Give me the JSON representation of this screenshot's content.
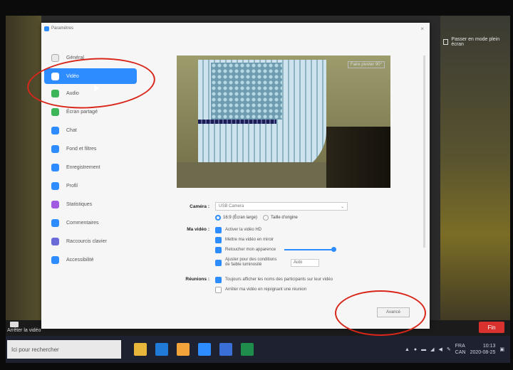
{
  "background": {
    "top_right_notice": "Passer en mode plein écran",
    "stop_video": "Arrêter la vidéo",
    "end_button": "Fin"
  },
  "dialog": {
    "title": "Paramètres",
    "close_glyph": "×",
    "nav": [
      {
        "label": "Général",
        "icon": "gear-icon",
        "color": "#e9e9e9",
        "active": false
      },
      {
        "label": "Vidéo",
        "icon": "video-icon",
        "color": "#ffffff",
        "active": true
      },
      {
        "label": "Audio",
        "icon": "headphones-icon",
        "color": "#3db65a",
        "active": false
      },
      {
        "label": "Écran partagé",
        "icon": "share-screen-icon",
        "color": "#3db65a",
        "active": false
      },
      {
        "label": "Chat",
        "icon": "chat-icon",
        "color": "#2d8cff",
        "active": false
      },
      {
        "label": "Fond et filtres",
        "icon": "background-icon",
        "color": "#2d8cff",
        "active": false
      },
      {
        "label": "Enregistrement",
        "icon": "record-icon",
        "color": "#2d8cff",
        "active": false
      },
      {
        "label": "Profil",
        "icon": "profile-icon",
        "color": "#2d8cff",
        "active": false
      },
      {
        "label": "Statistiques",
        "icon": "stats-icon",
        "color": "#a05be0",
        "active": false
      },
      {
        "label": "Commentaires",
        "icon": "feedback-icon",
        "color": "#2d8cff",
        "active": false
      },
      {
        "label": "Raccourcis clavier",
        "icon": "keyboard-icon",
        "color": "#6a6ad8",
        "active": false
      },
      {
        "label": "Accessibilité",
        "icon": "accessibility-icon",
        "color": "#2d8cff",
        "active": false
      }
    ],
    "preview_badge": "Faire pivoter 90°",
    "camera_label": "Caméra :",
    "camera_value": "USB Camera",
    "ratio_wide": "16:9 (Écran large)",
    "ratio_original": "Taille d'origine",
    "my_video_label": "Ma vidéo :",
    "hd": "Activer la vidéo HD",
    "mirror": "Mettre ma vidéo en miroir",
    "touch_up": "Retoucher mon apparence",
    "low_light": "Ajuster pour des conditions de faible luminosité",
    "low_light_mode": "Auto",
    "meetings_label": "Réunions :",
    "show_names": "Toujours afficher les noms des participants sur leur vidéo",
    "turn_off_video": "Arrêter ma vidéo en rejoignant une réunion",
    "advanced_button": "Avancé"
  },
  "taskbar": {
    "search_placeholder": "Ici pour rechercher",
    "lang_1": "FRA",
    "lang_2": "CAN",
    "time": "10:13",
    "date": "2020-08-25"
  }
}
